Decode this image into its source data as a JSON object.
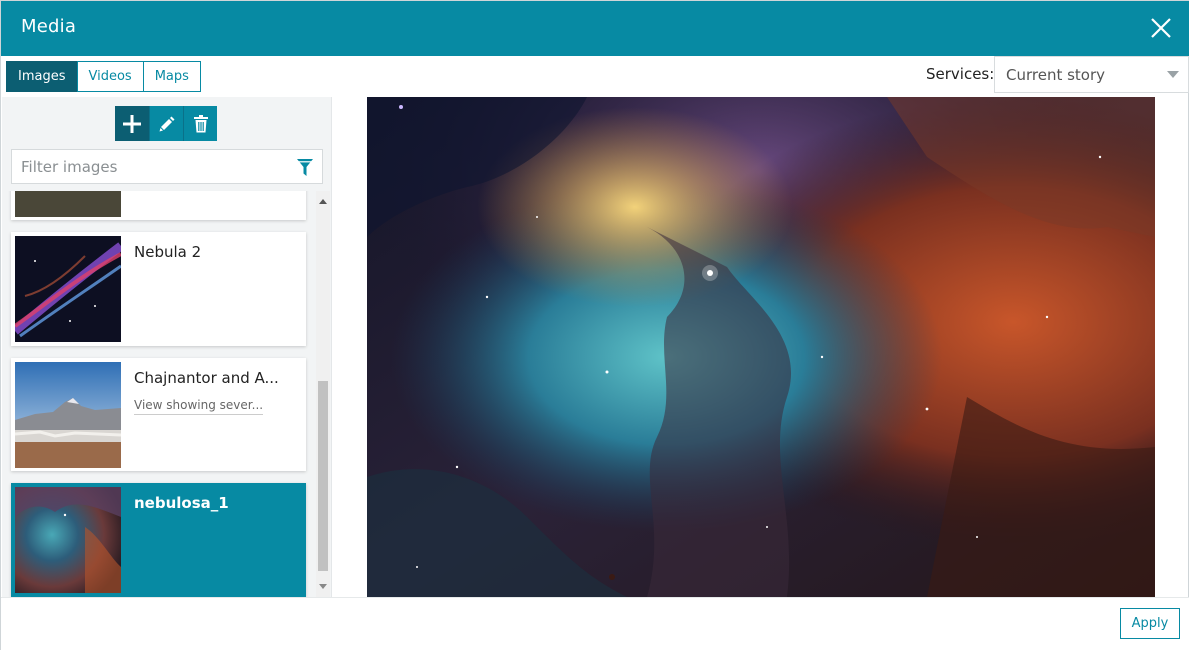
{
  "dialog": {
    "title": "Media"
  },
  "tabs": [
    {
      "label": "Images",
      "active": true
    },
    {
      "label": "Videos",
      "active": false
    },
    {
      "label": "Maps",
      "active": false
    }
  ],
  "services": {
    "label": "Services:",
    "selected": "Current story"
  },
  "toolbar": {
    "add_icon": "plus-icon",
    "edit_icon": "pencil-icon",
    "delete_icon": "trash-icon"
  },
  "filter": {
    "placeholder": "Filter images",
    "icon": "filter-icon"
  },
  "images": [
    {
      "name": "",
      "description": "",
      "selected": false
    },
    {
      "name": "Nebula 2",
      "description": "",
      "selected": false
    },
    {
      "name": "Chajnantor and A...",
      "description": "View showing sever...",
      "selected": false
    },
    {
      "name": "nebulosa_1",
      "description": "",
      "selected": true
    }
  ],
  "footer": {
    "apply_label": "Apply"
  },
  "colors": {
    "accent": "#078aa3",
    "accent_dark": "#0c5e72"
  }
}
